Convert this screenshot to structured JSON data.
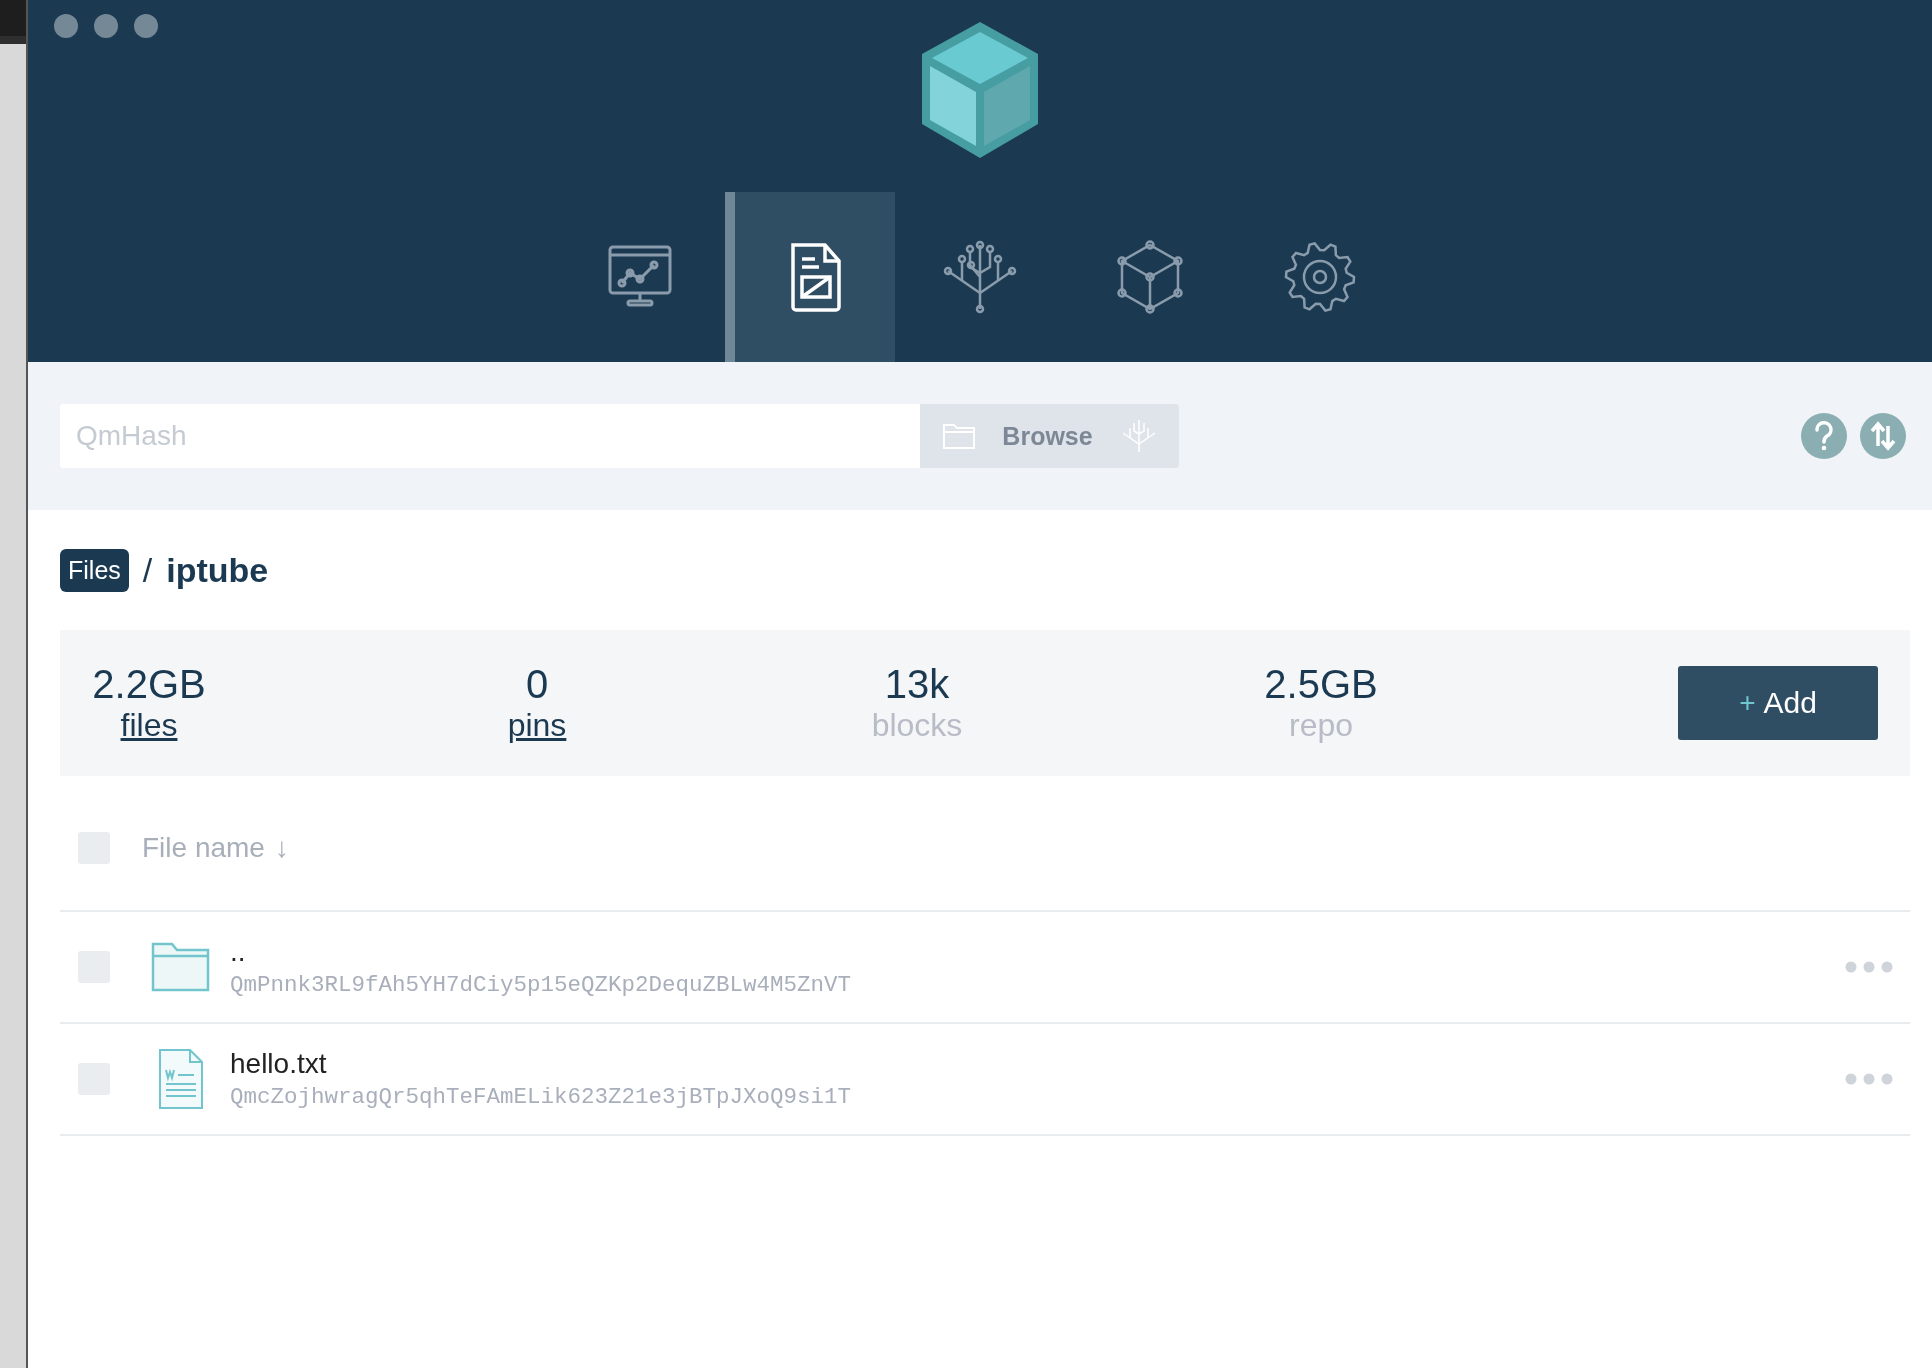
{
  "nav": {
    "tabs": [
      {
        "kind": "status",
        "selected": false
      },
      {
        "kind": "files",
        "selected": true
      },
      {
        "kind": "explore",
        "selected": false
      },
      {
        "kind": "peers",
        "selected": false
      },
      {
        "kind": "settings",
        "selected": false
      }
    ]
  },
  "search": {
    "placeholder": "QmHash",
    "button": "Browse"
  },
  "breadcrumb": {
    "root": "Files",
    "separator": "/",
    "current": "iptube"
  },
  "stats": [
    {
      "value": "2.2GB",
      "label": "files",
      "link": true
    },
    {
      "value": "0",
      "label": "pins",
      "link": true
    },
    {
      "value": "13k",
      "label": "blocks",
      "link": false
    },
    {
      "value": "2.5GB",
      "label": "repo",
      "link": false
    }
  ],
  "add_button": {
    "icon": "+",
    "label": "Add"
  },
  "table": {
    "header": {
      "label": "File name",
      "sort_indicator": "↓",
      "checked": false
    },
    "rows": [
      {
        "kind": "folder",
        "name": "..",
        "hash": "QmPnnk3RL9fAh5YH7dCiy5p15eQZKp2DequZBLw4M5ZnVT",
        "checked": false
      },
      {
        "kind": "file",
        "name": "hello.txt",
        "hash": "QmcZojhwragQr5qhTeFAmELik623Z21e3jBTpJXoQ9si1T",
        "checked": false
      }
    ]
  }
}
